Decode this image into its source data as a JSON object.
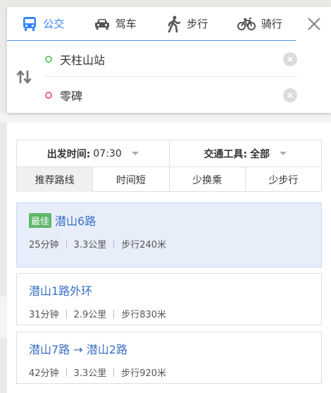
{
  "modes": [
    {
      "label": "公交",
      "icon": "bus-icon",
      "active": true
    },
    {
      "label": "驾车",
      "icon": "car-icon",
      "active": false
    },
    {
      "label": "步行",
      "icon": "walk-icon",
      "active": false
    },
    {
      "label": "骑行",
      "icon": "bicycle-icon",
      "active": false
    }
  ],
  "search": {
    "start": "天柱山站",
    "end": "零碑"
  },
  "filters": {
    "depart_label": "出发时间:",
    "depart_value": "07:30",
    "tool_label": "交通工具:",
    "tool_value": "全部"
  },
  "tabs": [
    "推荐路线",
    "时间短",
    "少换乘",
    "少步行"
  ],
  "routes": [
    {
      "badge": "最佳",
      "name": "潜山6路",
      "duration": "25分钟",
      "distance": "3.3公里",
      "walk": "步行240米"
    },
    {
      "name": "潜山1路外环",
      "duration": "31分钟",
      "distance": "2.9公里",
      "walk": "步行830米"
    },
    {
      "name": "潜山7路 → 潜山2路",
      "duration": "42分钟",
      "distance": "3.3公里",
      "walk": "步行920米"
    }
  ],
  "colors": {
    "accent": "#3385ff",
    "link": "#3a6fc4",
    "best_bg": "#e7eefa",
    "badge": "#5fb86a"
  }
}
